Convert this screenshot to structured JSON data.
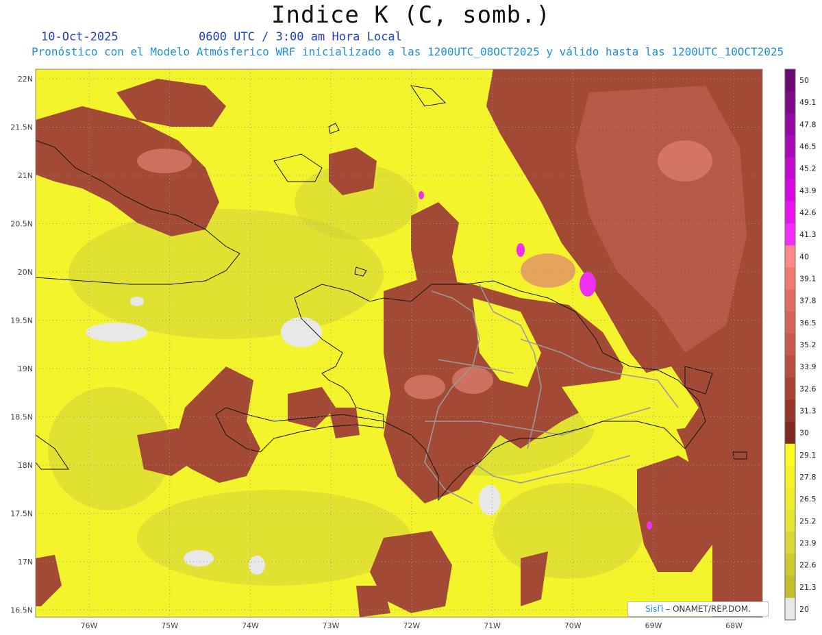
{
  "title": "Indice K (C, somb.)",
  "date_text": "10-Oct-2025",
  "time_text": "0600 UTC / 3:00 am Hora Local",
  "subtitle": "Pronóstico con el Modelo Atmósferico WRF inicializado a las 1200UTC_08OCT2025 y válido hasta las  1200UTC_10OCT2025",
  "credit": {
    "logo": "SisΠ",
    "text": "– ONAMET/REP.DOM."
  },
  "lat_labels": [
    "22N",
    "21.5N",
    "21N",
    "20.5N",
    "20N",
    "19.5N",
    "19N",
    "18.5N",
    "18N",
    "17.5N",
    "17N",
    "16.5N"
  ],
  "lon_labels": [
    "76W",
    "75W",
    "74W",
    "73W",
    "72W",
    "71W",
    "70W",
    "69W",
    "68W"
  ],
  "colorbar": {
    "labels": [
      "50",
      "49.1",
      "47.8",
      "46.5",
      "45.2",
      "43.9",
      "42.6",
      "41.3",
      "40",
      "39.1",
      "37.8",
      "36.5",
      "35.2",
      "33.9",
      "32.6",
      "31.3",
      "30",
      "29.1",
      "27.8",
      "26.5",
      "25.2",
      "23.9",
      "22.6",
      "21.3",
      "20"
    ],
    "colors": [
      "#6a0a6e",
      "#7e0a86",
      "#930aa0",
      "#a80ab6",
      "#c00acc",
      "#d60ae0",
      "#e814ee",
      "#f22ef7",
      "#ff8a8a",
      "#ef7a72",
      "#e06e62",
      "#d26458",
      "#c65a4e",
      "#b84e42",
      "#a84236",
      "#96362a",
      "#7e2a1c",
      "#fcfc22",
      "#f4f428",
      "#eeee2e",
      "#e4e434",
      "#d8d838",
      "#cccc30",
      "#c0c02c",
      "#e8e8e8"
    ]
  },
  "palette": {
    "low_yellow": "#f4f42c",
    "mid_olive": "#d2d236",
    "dark_brown": "#8b3a28",
    "brown": "#a24a36",
    "light_brown": "#c46456",
    "pink": "#e08070",
    "magenta": "#f030f0",
    "gray": "#e8e8e8",
    "coast": "#111111",
    "border": "#9a9a9a"
  }
}
